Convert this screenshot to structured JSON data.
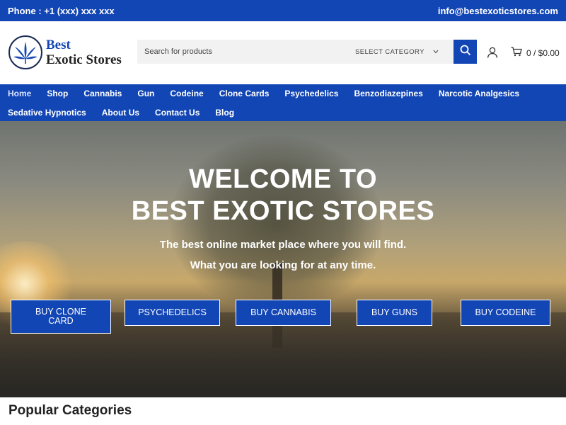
{
  "topbar": {
    "phone": "Phone : +1 (xxx) xxx xxx",
    "email": "info@bestexoticstores.com"
  },
  "logo": {
    "line1": "Best",
    "line2": "Exotic Stores"
  },
  "search": {
    "placeholder": "Search for products",
    "category_label": "SELECT CATEGORY"
  },
  "cart": {
    "count": "0",
    "total": "$0.00",
    "display": "0 / $0.00"
  },
  "nav": {
    "row1": [
      "Home",
      "Shop",
      "Cannabis",
      "Gun",
      "Codeine",
      "Clone Cards",
      "Psychedelics",
      "Benzodiazepines",
      "Narcotic Analgesics"
    ],
    "row2": [
      "Sedative Hypnotics",
      "About Us",
      "Contact Us",
      "Blog"
    ],
    "active": "Home"
  },
  "hero": {
    "title_line1": "WELCOME TO",
    "title_line2": "BEST EXOTIC STORES",
    "sub_line1": "The best online market place where you will find.",
    "sub_line2": "What you are looking for at any time.",
    "buttons": [
      {
        "line1": "BUY CLONE",
        "line2": "CARD"
      },
      {
        "label": "PSYCHEDELICS"
      },
      {
        "label": "BUY CANNABIS"
      },
      {
        "label": "BUY GUNS"
      },
      {
        "label": "BUY CODEINE"
      }
    ]
  },
  "section": {
    "popular_title": "Popular Categories"
  },
  "colors": {
    "brand": "#1346b5",
    "text": "#222222"
  },
  "icons": [
    "cannabis-leaf-icon",
    "search-icon",
    "chevron-down-icon",
    "user-icon",
    "cart-icon"
  ]
}
